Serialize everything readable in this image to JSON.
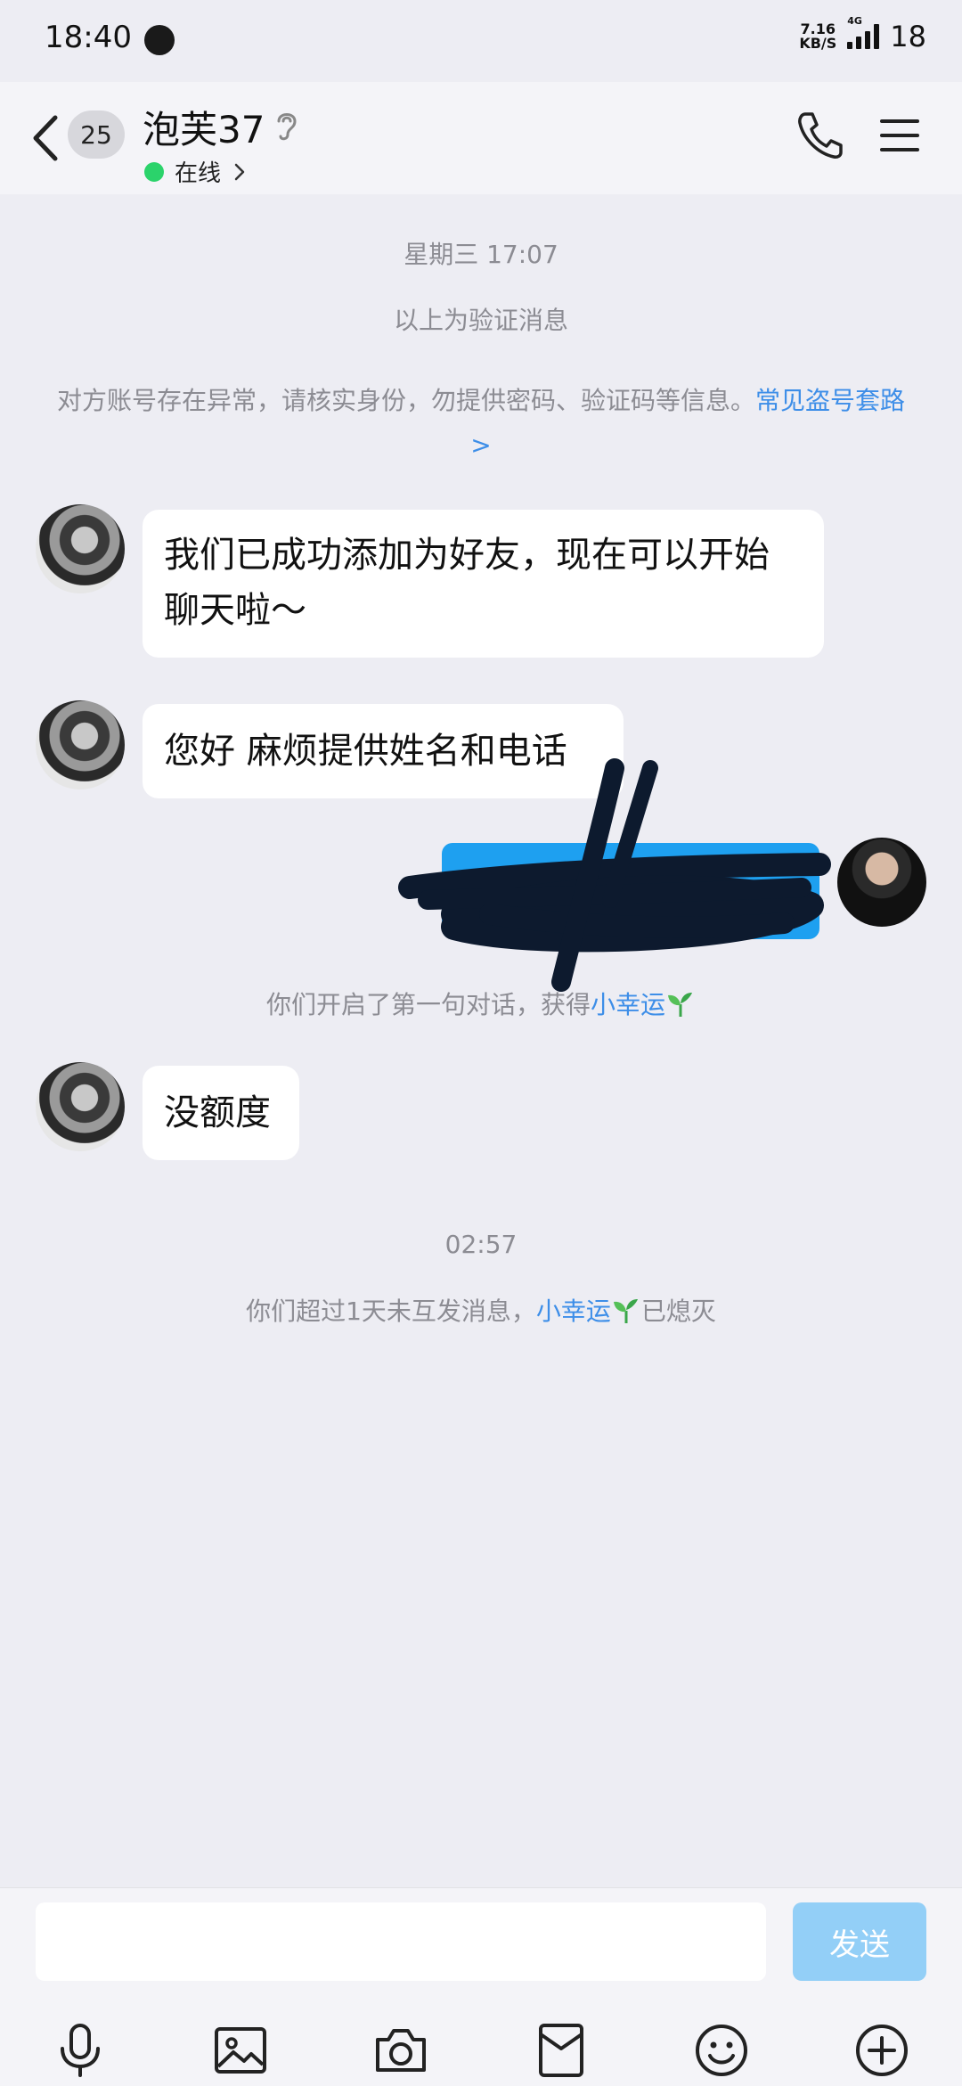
{
  "status_bar": {
    "time": "18:40",
    "net_speed_top": "7.16",
    "net_speed_bottom": "KB/S",
    "network": "4G",
    "battery": "18"
  },
  "header": {
    "unread_count": "25",
    "contact_name": "泡芙37",
    "status": "在线"
  },
  "chat": {
    "timestamp_1": "星期三 17:07",
    "verify_note": "以上为验证消息",
    "warning_text": "对方账号存在异常，请核实身份，勿提供密码、验证码等信息。",
    "warning_link": "常见盗号套路>",
    "messages": [
      {
        "side": "left",
        "text": "我们已成功添加为好友，现在可以开始聊天啦～"
      },
      {
        "side": "left",
        "text": "您好  麻烦提供姓名和电话"
      },
      {
        "side": "right",
        "text": ""
      },
      {
        "side": "left",
        "text": "没额度"
      }
    ],
    "luck_note_1_prefix": "你们开启了第一句对话，获得",
    "luck_note_1_link": "小幸运",
    "timestamp_2": "02:57",
    "luck_note_2_prefix": "你们超过1天未互发消息，",
    "luck_note_2_link": "小幸运",
    "luck_note_2_suffix": "已熄灭"
  },
  "input": {
    "value": "",
    "placeholder": "",
    "send_label": "发送"
  },
  "toolbar": [
    "mic-icon",
    "image-icon",
    "camera-icon",
    "red-packet-icon",
    "emoji-icon",
    "plus-icon"
  ],
  "colors": {
    "background": "#ededf3",
    "link": "#3d8ee8",
    "online": "#2bd36b",
    "my_bubble": "#1ea0f0",
    "send_disabled": "#93cff7"
  }
}
